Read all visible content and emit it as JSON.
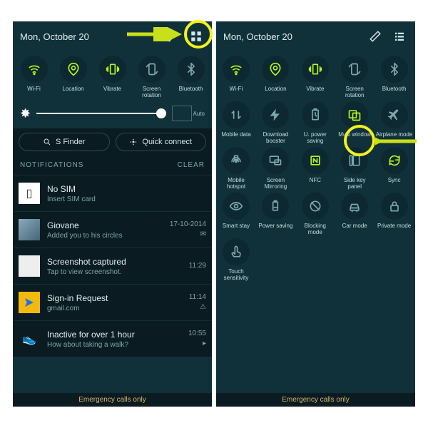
{
  "left": {
    "date": "Mon, October 20",
    "toggles": [
      {
        "label": "Wi-Fi",
        "icon": "wifi",
        "state": "on"
      },
      {
        "label": "Location",
        "icon": "location",
        "state": "on"
      },
      {
        "label": "Vibrate",
        "icon": "vibrate",
        "state": "on"
      },
      {
        "label": "Screen rotation",
        "icon": "rotation",
        "state": "off"
      },
      {
        "label": "Bluetooth",
        "icon": "bluetooth",
        "state": "off"
      }
    ],
    "brightness_auto": "Auto",
    "sfinder": "S Finder",
    "quickconnect": "Quick connect",
    "notif_header": "NOTIFICATIONS",
    "clear": "CLEAR",
    "notifs": [
      {
        "title": "No SIM",
        "sub": "Insert SIM card",
        "time": "",
        "meta": ""
      },
      {
        "title": "Giovane",
        "sub": "Added you to his circles",
        "time": "17-10-2014",
        "meta": "✉"
      },
      {
        "title": "Screenshot captured",
        "sub": "Tap to view screenshot.",
        "time": "11:29",
        "meta": ""
      },
      {
        "title": "Sign-in Request",
        "sub": "gmail.com",
        "time": "11:14",
        "meta": "⚠"
      },
      {
        "title": "Inactive for over 1 hour",
        "sub": "How about taking a walk?",
        "time": "10:55",
        "meta": "▸"
      }
    ],
    "footer": "Emergency calls only"
  },
  "right": {
    "date": "Mon, October 20",
    "toggles": [
      {
        "label": "Wi-Fi",
        "icon": "wifi",
        "state": "on"
      },
      {
        "label": "Location",
        "icon": "location",
        "state": "on"
      },
      {
        "label": "Vibrate",
        "icon": "vibrate",
        "state": "on"
      },
      {
        "label": "Screen rotation",
        "icon": "rotation",
        "state": "off"
      },
      {
        "label": "Bluetooth",
        "icon": "bluetooth",
        "state": "off"
      },
      {
        "label": "Mobile data",
        "icon": "mobiledata",
        "state": "off"
      },
      {
        "label": "Download booster",
        "icon": "booster",
        "state": "off"
      },
      {
        "label": "U. power saving",
        "icon": "upower",
        "state": "off"
      },
      {
        "label": "Multi window",
        "icon": "multiwindow",
        "state": "on"
      },
      {
        "label": "Airplane mode",
        "icon": "airplane",
        "state": "off"
      },
      {
        "label": "Mobile hotspot",
        "icon": "hotspot",
        "state": "off"
      },
      {
        "label": "Screen Mirroring",
        "icon": "mirroring",
        "state": "off"
      },
      {
        "label": "NFC",
        "icon": "nfc",
        "state": "on"
      },
      {
        "label": "Side key panel",
        "icon": "sidekey",
        "state": "off"
      },
      {
        "label": "Sync",
        "icon": "sync",
        "state": "on"
      },
      {
        "label": "Smart stay",
        "icon": "smartstay",
        "state": "off"
      },
      {
        "label": "Power saving",
        "icon": "psaving",
        "state": "off"
      },
      {
        "label": "Blocking mode",
        "icon": "blocking",
        "state": "off"
      },
      {
        "label": "Car mode",
        "icon": "car",
        "state": "off"
      },
      {
        "label": "Private mode",
        "icon": "private",
        "state": "off"
      },
      {
        "label": "Touch sensitivity",
        "icon": "touch",
        "state": "off"
      }
    ],
    "footer": "Emergency calls only"
  }
}
